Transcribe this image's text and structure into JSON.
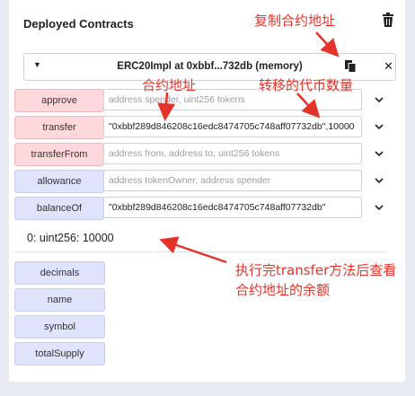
{
  "panel": {
    "title": "Deployed Contracts"
  },
  "contract": {
    "name": "ERC20Impl at 0xbbf...732db (memory)"
  },
  "functions": [
    {
      "label": "approve",
      "type": "transact",
      "value": "",
      "placeholder": "address spender, uint256 tokens"
    },
    {
      "label": "transfer",
      "type": "transact",
      "value": "\"0xbbf289d846208c16edc8474705c748aff07732db\",10000",
      "placeholder": ""
    },
    {
      "label": "transferFrom",
      "type": "transact",
      "value": "",
      "placeholder": "address from, address to, uint256 tokens"
    },
    {
      "label": "allowance",
      "type": "call",
      "value": "",
      "placeholder": "address tokenOwner, address spender"
    },
    {
      "label": "balanceOf",
      "type": "call",
      "value": "\"0xbbf289d846208c16edc8474705c748aff07732db\"",
      "placeholder": ""
    }
  ],
  "result": "0: uint256: 10000",
  "calls": [
    "decimals",
    "name",
    "symbol",
    "totalSupply"
  ],
  "annotations": {
    "copy_address": "复制合约地址",
    "contract_address": "合约地址",
    "amount": "转移的代币数量",
    "note_line1": "执行完transfer方法后查看",
    "note_line2": "合约地址的余额"
  },
  "icons": {
    "trash": "trash-icon",
    "copy": "copy-icon",
    "close": "close-icon",
    "caret": "caret-down-icon",
    "chevron": "chevron-down-icon"
  },
  "colors": {
    "transact": "#ffd8db",
    "call": "#dfe3fb",
    "annotation": "#e6332a",
    "background": "#e9ebf3"
  }
}
